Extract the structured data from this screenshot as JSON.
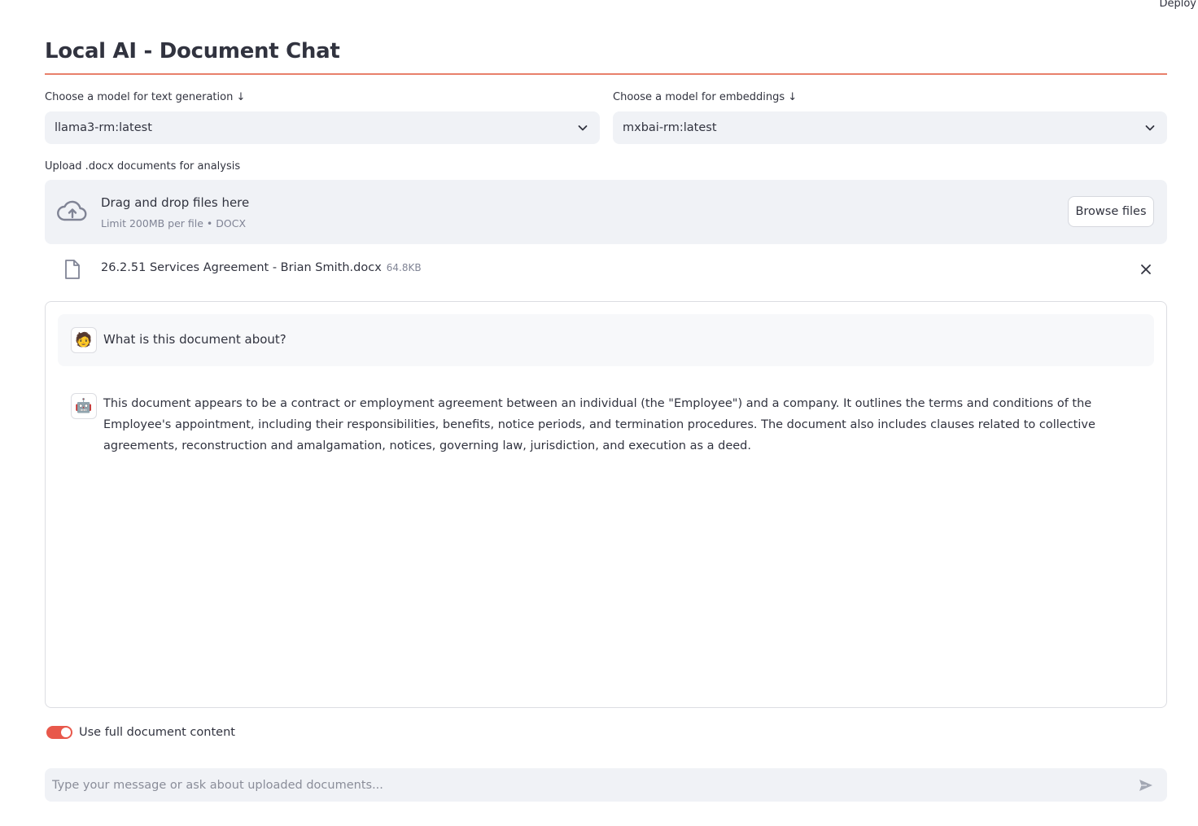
{
  "header": {
    "deploy_label": "Deploy"
  },
  "page": {
    "title": "Local AI - Document Chat"
  },
  "text_model": {
    "label": "Choose a model for text generation ↓",
    "selected": "llama3-rm:latest"
  },
  "embedding_model": {
    "label": "Choose a model for embeddings ↓",
    "selected": "mxbai-rm:latest"
  },
  "uploader": {
    "label": "Upload .docx documents for analysis",
    "drop_title": "Drag and drop files here",
    "drop_subtitle": "Limit 200MB per file • DOCX",
    "browse_label": "Browse files"
  },
  "uploaded_file": {
    "name": "26.2.51 Services Agreement - Brian Smith.docx",
    "size": "64.8KB"
  },
  "chat": {
    "messages": [
      {
        "role": "user",
        "avatar": "🧑",
        "text": "What is this document about?"
      },
      {
        "role": "assistant",
        "avatar": "🤖",
        "text": "This document appears to be a contract or employment agreement between an individual (the \"Employee\") and a company. It outlines the terms and conditions of the Employee's appointment, including their responsibilities, benefits, notice periods, and termination procedures. The document also includes clauses related to collective agreements, reconstruction and amalgamation, notices, governing law, jurisdiction, and execution as a deed."
      }
    ]
  },
  "toggle": {
    "label": "Use full document content",
    "on": true
  },
  "input": {
    "placeholder": "Type your message or ask about uploaded documents..."
  },
  "colors": {
    "accent": "#e8584b",
    "rule": "#e8806b",
    "surface": "#f0f2f6",
    "text": "#31333f",
    "muted": "#808495"
  }
}
